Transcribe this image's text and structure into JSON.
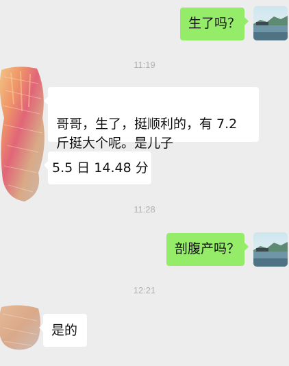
{
  "chat": {
    "messages": [
      {
        "side": "out",
        "text": "生了吗？"
      },
      {
        "side": "in",
        "text": "哥哥，生了，挺顺利的，有 7.2\n斤挺大个呢。是儿子"
      },
      {
        "side": "in",
        "text": "5.5 日 14.48 分"
      },
      {
        "side": "out",
        "text": "剖腹产吗？"
      },
      {
        "side": "in",
        "text": "是的"
      }
    ],
    "timestamps": [
      "11:19",
      "11:28",
      "12:21"
    ]
  },
  "icons": {
    "self_avatar": "landscape-avatar-icon",
    "contact_avatar": "colorful-pastel-avatar-icon"
  },
  "colors": {
    "background": "#ededed",
    "outgoing_bubble": "#95ec69",
    "incoming_bubble": "#ffffff",
    "timestamp": "#b2b2b2"
  }
}
